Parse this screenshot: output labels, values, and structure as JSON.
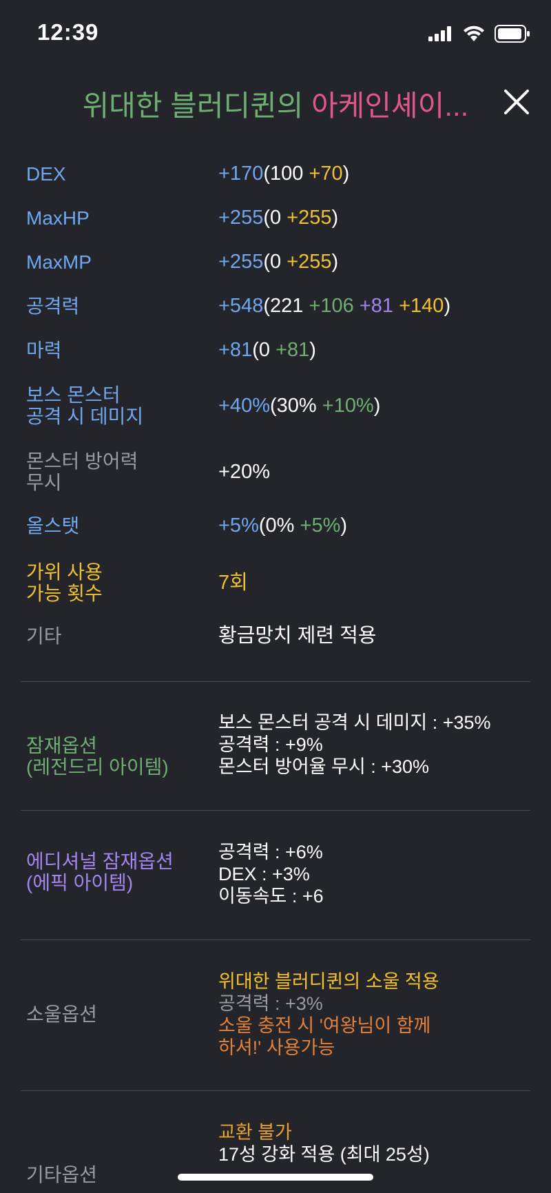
{
  "status_bar": {
    "time": "12:39"
  },
  "header": {
    "title_part1": "위대한 블러디퀸의 ",
    "title_part2": "아케인셰이..."
  },
  "stats": [
    {
      "label": "DEX",
      "total": "+170",
      "base": "100",
      "bonuses": [
        {
          "text": "+70",
          "color": "gold"
        }
      ]
    },
    {
      "label": "MaxHP",
      "total": "+255",
      "base": "0",
      "bonuses": [
        {
          "text": "+255",
          "color": "gold"
        }
      ]
    },
    {
      "label": "MaxMP",
      "total": "+255",
      "base": "0",
      "bonuses": [
        {
          "text": "+255",
          "color": "gold"
        }
      ]
    },
    {
      "label": "공격력",
      "total": "+548",
      "base": "221",
      "bonuses": [
        {
          "text": "+106",
          "color": "green"
        },
        {
          "text": "+81",
          "color": "purple"
        },
        {
          "text": "+140",
          "color": "gold"
        }
      ]
    },
    {
      "label": "마력",
      "total": "+81",
      "base": "0",
      "bonuses": [
        {
          "text": "+81",
          "color": "green"
        }
      ]
    }
  ],
  "boss_damage": {
    "label_line1": "보스 몬스터",
    "label_line2": "공격 시 데미지",
    "total": "+40%",
    "base": "30%",
    "bonus": "+10%"
  },
  "ignore_def": {
    "label_line1": "몬스터 방어력",
    "label_line2": "무시",
    "value": "+20%"
  },
  "all_stat": {
    "label": "올스탯",
    "total": "+5%",
    "base": "0%",
    "bonus": "+5%"
  },
  "scissors": {
    "label_line1": "가위 사용",
    "label_line2": "가능 횟수",
    "value": "7회"
  },
  "etc": {
    "label": "기타",
    "value": "황금망치 제련 적용"
  },
  "potential": {
    "label_line1": "잠재옵션",
    "label_line2": "(레전드리 아이템)",
    "lines": [
      "보스 몬스터 공격 시 데미지 : +35%",
      "공격력 : +9%",
      "몬스터 방어율 무시 : +30%"
    ]
  },
  "additional_potential": {
    "label_line1": "에디셔널 잠재옵션",
    "label_line2": "(에픽 아이템)",
    "lines": [
      "공격력 : +6%",
      "DEX : +3%",
      "이동속도 : +6"
    ]
  },
  "soul": {
    "label": "소울옵션",
    "line1": "위대한 블러디퀸의 소울 적용",
    "line2": "공격력 : +3%",
    "line3": "소울 충전 시 '여왕님이 함께",
    "line4": "하셔!' 사용가능"
  },
  "other_options": {
    "label": "기타옵션",
    "line1": "교환 불가",
    "line2": "17성 강화 적용 (최대 25성)"
  },
  "colors": {
    "background": "#24252a",
    "blue": "#6fa7f0",
    "gold": "#f2c130",
    "green": "#6fae72",
    "purple": "#a285f0",
    "pink": "#e05788",
    "orange": "#e8a030"
  }
}
